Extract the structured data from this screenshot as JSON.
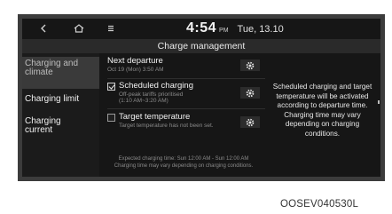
{
  "status_bar": {
    "time": "4:54",
    "ampm": "PM",
    "date": "Tue, 13.10"
  },
  "page_title": "Charge management",
  "sidebar": {
    "items": [
      {
        "label_line1": "Charging and",
        "label_line2": "climate"
      },
      {
        "label": "Charging limit"
      },
      {
        "label_line1": "Charging",
        "label_line2": "current"
      }
    ]
  },
  "main": {
    "next_departure": {
      "title": "Next departure",
      "detail": "Oct 19 (Mon) 3:50 AM"
    },
    "scheduled_charging": {
      "title": "Scheduled charging",
      "checked": true,
      "detail_line1": "Off-peak tariffs prioritised",
      "detail_line2": "(1:10 AM~3:20 AM)"
    },
    "target_temperature": {
      "title": "Target temperature",
      "checked": false,
      "detail": "Target temperature has not been set."
    },
    "footnote_line1": "Expected charging time: Sun 12:00 AM - Sun 12:00 AM",
    "footnote_line2": "Charging time may vary depending on charging conditions."
  },
  "info_panel": {
    "lines": [
      "Scheduled charging and target",
      "temperature will be activated",
      "according to departure time.",
      "Charging time may vary",
      "depending on charging",
      "conditions."
    ]
  },
  "image_code": "OOSEV040530L",
  "icons": {
    "back": "chevron-left-icon",
    "home": "home-icon",
    "menu": "menu-icon",
    "settings": "gear-icon"
  },
  "colors": {
    "screen_bg": "#161616",
    "bezel": "#3c3c3c",
    "title_bar": "#2a2a2a",
    "selected_item": "#3a3a3a"
  }
}
